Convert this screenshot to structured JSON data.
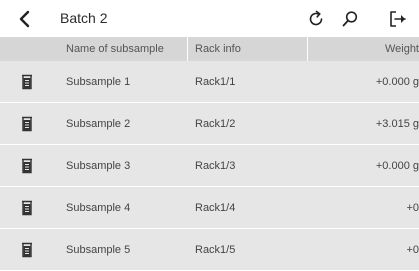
{
  "topbar": {
    "title": "Batch 2",
    "icons": [
      "back-chevron-icon",
      "refresh-icon",
      "search-icon",
      "logout-icon"
    ]
  },
  "table": {
    "columns": [
      "Name of subsample",
      "Rack info",
      "Weight"
    ],
    "rows": [
      {
        "icon": "beaker-icon",
        "name": "Subsample 1",
        "rack": "Rack1/1",
        "weight": "+0.000 g"
      },
      {
        "icon": "beaker-icon",
        "name": "Subsample 2",
        "rack": "Rack1/2",
        "weight": "+3.015 g"
      },
      {
        "icon": "beaker-icon",
        "name": "Subsample 3",
        "rack": "Rack1/3",
        "weight": "+0.000 g"
      },
      {
        "icon": "beaker-icon",
        "name": "Subsample 4",
        "rack": "Rack1/4",
        "weight": "+0"
      },
      {
        "icon": "beaker-icon",
        "name": "Subsample 5",
        "rack": "Rack1/5",
        "weight": "+0"
      }
    ]
  },
  "colors": {
    "header_bg": "#d6d6d6",
    "row_bg": "#e6e6e6",
    "text": "#333333"
  }
}
